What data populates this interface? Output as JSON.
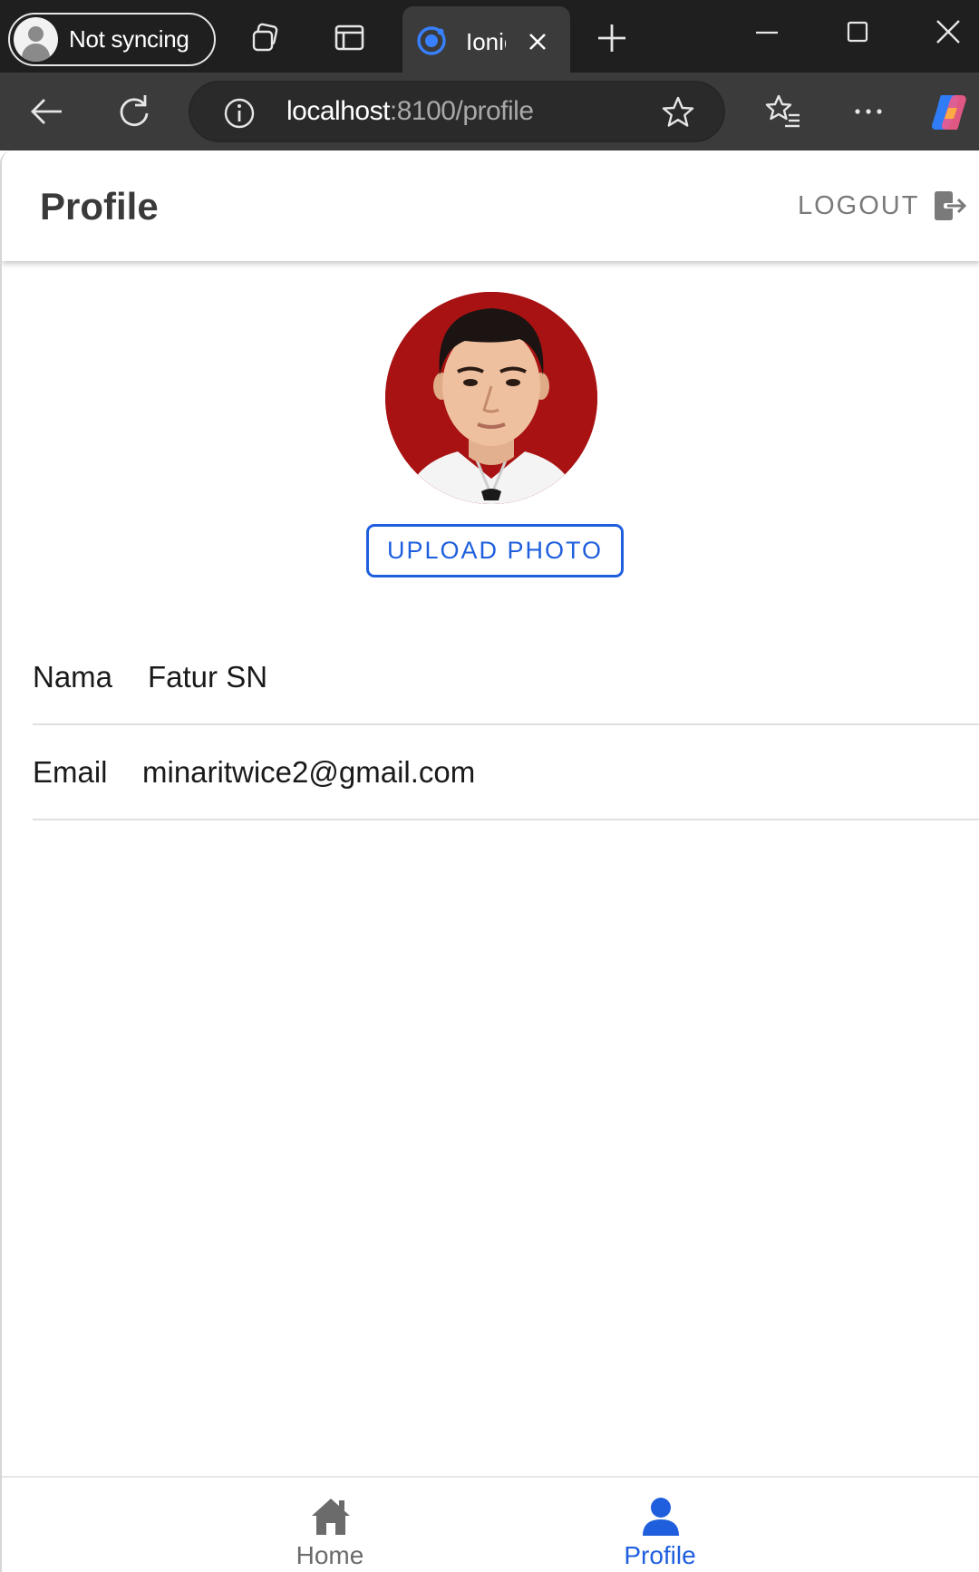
{
  "browser": {
    "profile_label": "Not syncing",
    "tab_title": "Ionic",
    "url_host": "localhost",
    "url_path": ":8100/profile"
  },
  "header": {
    "title": "Profile",
    "logout_label": "LOGOUT"
  },
  "profile": {
    "photo_background": "#a81212",
    "upload_label": "UPLOAD PHOTO",
    "fields": [
      {
        "label": "Nama",
        "value": "Fatur SN"
      },
      {
        "label": "Email",
        "value": "minaritwice2@gmail.com"
      }
    ]
  },
  "tabbar": {
    "items": [
      {
        "label": "Home",
        "icon": "home-icon",
        "active": false
      },
      {
        "label": "Profile",
        "icon": "person-icon",
        "active": true
      }
    ]
  },
  "colors": {
    "accent": "#1f5fde",
    "inactive_tab": "#6b6b6b",
    "tabstrip": "#1f1f1f",
    "toolbar": "#3b3b3b"
  }
}
